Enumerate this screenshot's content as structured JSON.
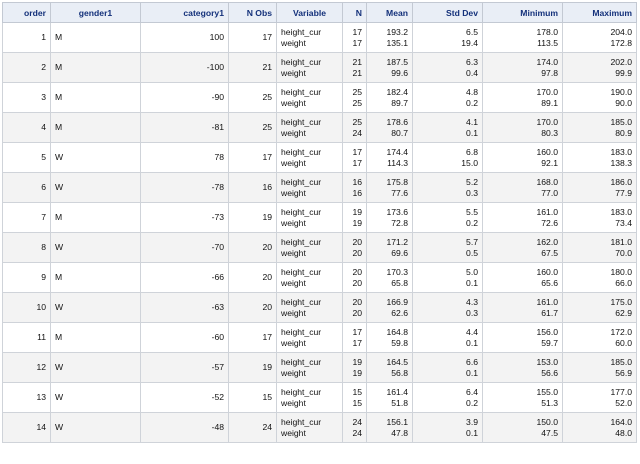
{
  "columns": [
    "order",
    "gender1",
    "category1",
    "N Obs",
    "Variable",
    "N",
    "Mean",
    "Std Dev",
    "Minimum",
    "Maximum"
  ],
  "rows": [
    {
      "order": "1",
      "gender": "M",
      "category": "100",
      "nobs": "17",
      "vars": [
        "height_cur",
        "weight"
      ],
      "n": [
        "17",
        "17"
      ],
      "mean": [
        "193.2",
        "135.1"
      ],
      "std": [
        "6.5",
        "19.4"
      ],
      "min": [
        "178.0",
        "113.5"
      ],
      "max": [
        "204.0",
        "172.8"
      ]
    },
    {
      "order": "2",
      "gender": "M",
      "category": "-100",
      "nobs": "21",
      "vars": [
        "height_cur",
        "weight"
      ],
      "n": [
        "21",
        "21"
      ],
      "mean": [
        "187.5",
        "99.6"
      ],
      "std": [
        "6.3",
        "0.4"
      ],
      "min": [
        "174.0",
        "97.8"
      ],
      "max": [
        "202.0",
        "99.9"
      ]
    },
    {
      "order": "3",
      "gender": "M",
      "category": "-90",
      "nobs": "25",
      "vars": [
        "height_cur",
        "weight"
      ],
      "n": [
        "25",
        "25"
      ],
      "mean": [
        "182.4",
        "89.7"
      ],
      "std": [
        "4.8",
        "0.2"
      ],
      "min": [
        "170.0",
        "89.1"
      ],
      "max": [
        "190.0",
        "90.0"
      ]
    },
    {
      "order": "4",
      "gender": "M",
      "category": "-81",
      "nobs": "25",
      "vars": [
        "height_cur",
        "weight"
      ],
      "n": [
        "25",
        "24"
      ],
      "mean": [
        "178.6",
        "80.7"
      ],
      "std": [
        "4.1",
        "0.1"
      ],
      "min": [
        "170.0",
        "80.3"
      ],
      "max": [
        "185.0",
        "80.9"
      ]
    },
    {
      "order": "5",
      "gender": "W",
      "category": "78",
      "nobs": "17",
      "vars": [
        "height_cur",
        "weight"
      ],
      "n": [
        "17",
        "17"
      ],
      "mean": [
        "174.4",
        "114.3"
      ],
      "std": [
        "6.8",
        "15.0"
      ],
      "min": [
        "160.0",
        "92.1"
      ],
      "max": [
        "183.0",
        "138.3"
      ]
    },
    {
      "order": "6",
      "gender": "W",
      "category": "-78",
      "nobs": "16",
      "vars": [
        "height_cur",
        "weight"
      ],
      "n": [
        "16",
        "16"
      ],
      "mean": [
        "175.8",
        "77.6"
      ],
      "std": [
        "5.2",
        "0.3"
      ],
      "min": [
        "168.0",
        "77.0"
      ],
      "max": [
        "186.0",
        "77.9"
      ]
    },
    {
      "order": "7",
      "gender": "M",
      "category": "-73",
      "nobs": "19",
      "vars": [
        "height_cur",
        "weight"
      ],
      "n": [
        "19",
        "19"
      ],
      "mean": [
        "173.6",
        "72.8"
      ],
      "std": [
        "5.5",
        "0.2"
      ],
      "min": [
        "161.0",
        "72.6"
      ],
      "max": [
        "183.0",
        "73.4"
      ]
    },
    {
      "order": "8",
      "gender": "W",
      "category": "-70",
      "nobs": "20",
      "vars": [
        "height_cur",
        "weight"
      ],
      "n": [
        "20",
        "20"
      ],
      "mean": [
        "171.2",
        "69.6"
      ],
      "std": [
        "5.7",
        "0.5"
      ],
      "min": [
        "162.0",
        "67.5"
      ],
      "max": [
        "181.0",
        "70.0"
      ]
    },
    {
      "order": "9",
      "gender": "M",
      "category": "-66",
      "nobs": "20",
      "vars": [
        "height_cur",
        "weight"
      ],
      "n": [
        "20",
        "20"
      ],
      "mean": [
        "170.3",
        "65.8"
      ],
      "std": [
        "5.0",
        "0.1"
      ],
      "min": [
        "160.0",
        "65.6"
      ],
      "max": [
        "180.0",
        "66.0"
      ]
    },
    {
      "order": "10",
      "gender": "W",
      "category": "-63",
      "nobs": "20",
      "vars": [
        "height_cur",
        "weight"
      ],
      "n": [
        "20",
        "20"
      ],
      "mean": [
        "166.9",
        "62.6"
      ],
      "std": [
        "4.3",
        "0.3"
      ],
      "min": [
        "161.0",
        "61.7"
      ],
      "max": [
        "175.0",
        "62.9"
      ]
    },
    {
      "order": "11",
      "gender": "M",
      "category": "-60",
      "nobs": "17",
      "vars": [
        "height_cur",
        "weight"
      ],
      "n": [
        "17",
        "17"
      ],
      "mean": [
        "164.8",
        "59.8"
      ],
      "std": [
        "4.4",
        "0.1"
      ],
      "min": [
        "156.0",
        "59.7"
      ],
      "max": [
        "172.0",
        "60.0"
      ]
    },
    {
      "order": "12",
      "gender": "W",
      "category": "-57",
      "nobs": "19",
      "vars": [
        "height_cur",
        "weight"
      ],
      "n": [
        "19",
        "19"
      ],
      "mean": [
        "164.5",
        "56.8"
      ],
      "std": [
        "6.6",
        "0.1"
      ],
      "min": [
        "153.0",
        "56.6"
      ],
      "max": [
        "185.0",
        "56.9"
      ]
    },
    {
      "order": "13",
      "gender": "W",
      "category": "-52",
      "nobs": "15",
      "vars": [
        "height_cur",
        "weight"
      ],
      "n": [
        "15",
        "15"
      ],
      "mean": [
        "161.4",
        "51.8"
      ],
      "std": [
        "6.4",
        "0.2"
      ],
      "min": [
        "155.0",
        "51.3"
      ],
      "max": [
        "177.0",
        "52.0"
      ]
    },
    {
      "order": "14",
      "gender": "W",
      "category": "-48",
      "nobs": "24",
      "vars": [
        "height_cur",
        "weight"
      ],
      "n": [
        "24",
        "24"
      ],
      "mean": [
        "156.1",
        "47.8"
      ],
      "std": [
        "3.9",
        "0.1"
      ],
      "min": [
        "150.0",
        "47.5"
      ],
      "max": [
        "164.0",
        "48.0"
      ]
    }
  ]
}
